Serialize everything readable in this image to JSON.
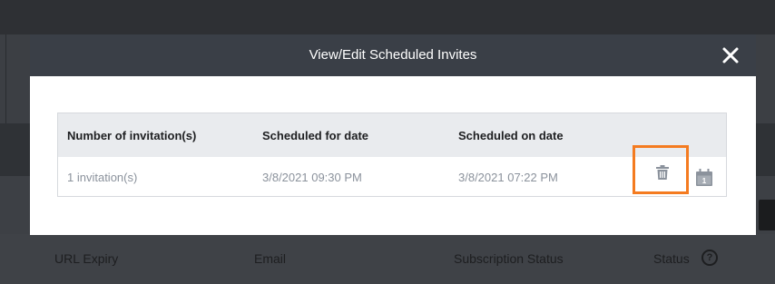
{
  "modal": {
    "title": "View/Edit Scheduled Invites",
    "close_icon": "close-icon"
  },
  "table": {
    "columns": [
      "Number of invitation(s)",
      "Scheduled for date",
      "Scheduled on date"
    ],
    "rows": [
      {
        "invitations": "1 invitation(s)",
        "scheduled_for": "3/8/2021 09:30 PM",
        "scheduled_on": "3/8/2021 07:22 PM",
        "delete_icon": "trash-icon",
        "reschedule_icon": "calendar-icon",
        "calendar_day": "1"
      }
    ]
  },
  "background": {
    "columns": [
      "URL Expiry",
      "Email",
      "Subscription Status",
      "Status"
    ],
    "help_icon_glyph": "?"
  },
  "colors": {
    "highlight": "#f47b20",
    "modal_header": "#3a3f47",
    "table_header": "#e9ebee",
    "icon": "#8b929c"
  }
}
